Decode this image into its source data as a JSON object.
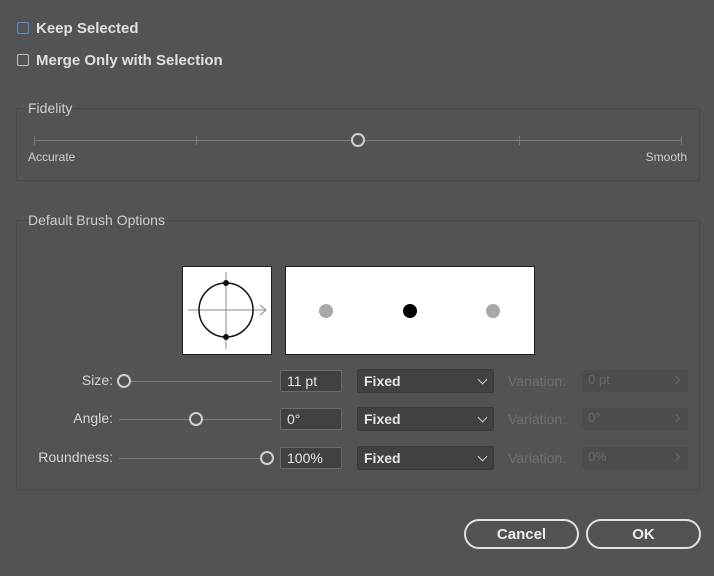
{
  "checkboxes": {
    "keep_selected": {
      "label": "Keep Selected",
      "checked": false
    },
    "merge_only": {
      "label": "Merge Only with Selection",
      "checked": false
    }
  },
  "fidelity": {
    "title": "Fidelity",
    "min_label": "Accurate",
    "max_label": "Smooth",
    "value_fraction": 0.5
  },
  "brush": {
    "title": "Default Brush Options",
    "rows": [
      {
        "label": "Size:",
        "value": "11 pt",
        "mode": "Fixed",
        "variation_label": "Variation:",
        "variation_value": "0 pt",
        "slider_fraction": 0.03
      },
      {
        "label": "Angle:",
        "value": "0°",
        "mode": "Fixed",
        "variation_label": "Variation:",
        "variation_value": "0°",
        "slider_fraction": 0.52
      },
      {
        "label": "Roundness:",
        "value": "100%",
        "mode": "Fixed",
        "variation_label": "Variation:",
        "variation_value": "0%",
        "slider_fraction": 1.0
      }
    ]
  },
  "buttons": {
    "cancel": "Cancel",
    "ok": "OK"
  },
  "colors": {
    "background": "#535353",
    "focus": "#4a90d9"
  }
}
